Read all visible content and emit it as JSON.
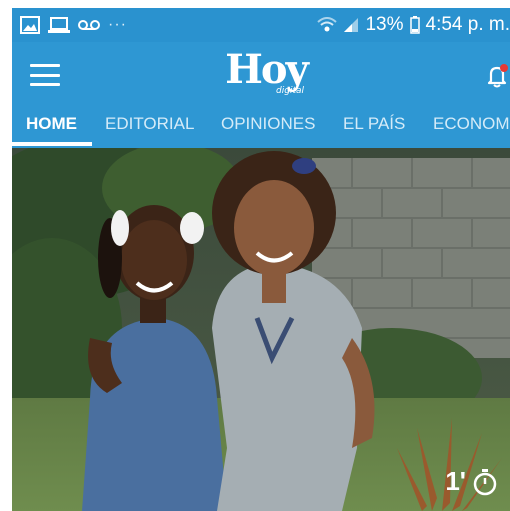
{
  "status_bar": {
    "left_icons": [
      "image-icon",
      "laptop-icon",
      "voicemail-icon"
    ],
    "overflow": "···",
    "battery": "13%",
    "time": "4:54 p. m."
  },
  "app_bar": {
    "logo_text": "Hoy",
    "logo_subtext": "digital"
  },
  "tabs": [
    {
      "label": "HOME",
      "active": true
    },
    {
      "label": "EDITORIAL",
      "active": false
    },
    {
      "label": "OPINIONES",
      "active": false
    },
    {
      "label": "EL PAÍS",
      "active": false
    },
    {
      "label": "ECONOM",
      "active": false
    }
  ],
  "article": {
    "read_time": "1'"
  },
  "colors": {
    "brand_blue": "#2e97d3",
    "text_white": "#ffffff",
    "notification_dot": "#e53935"
  }
}
